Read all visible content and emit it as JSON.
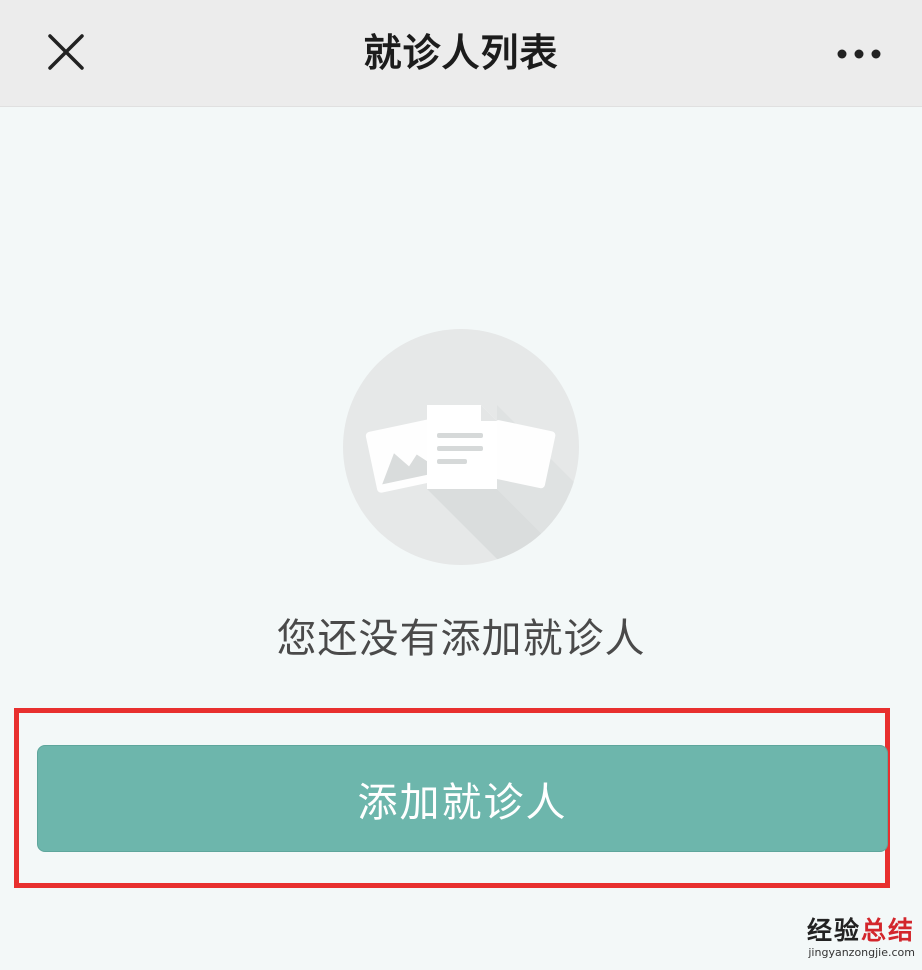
{
  "header": {
    "title": "就诊人列表",
    "close_icon": "close-icon",
    "more_icon": "more-icon"
  },
  "empty_state": {
    "icon": "document-image-icon",
    "message": "您还没有添加就诊人"
  },
  "add_patient_button": {
    "label": "添加就诊人",
    "color": "#6db6ac"
  },
  "highlight": {
    "color": "#e8302f"
  },
  "watermark": {
    "part1": "经验",
    "part2": "总结",
    "url": "jingyanzongjie.com"
  }
}
